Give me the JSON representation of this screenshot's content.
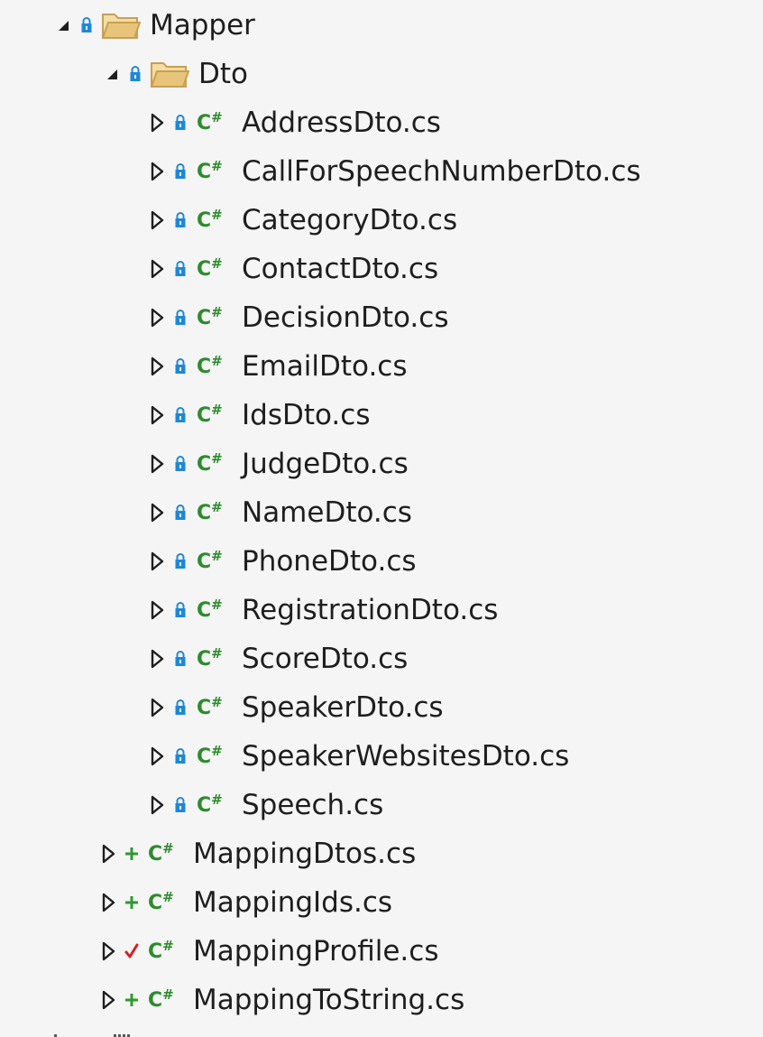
{
  "tree": {
    "root": {
      "label": "Mapper",
      "expanded": true,
      "status_icon": "lock-icon",
      "icon": "folder-icon"
    },
    "dto_folder": {
      "label": "Dto",
      "expanded": true,
      "status_icon": "lock-icon",
      "icon": "folder-icon"
    },
    "dto_files": [
      {
        "label": "AddressDto.cs",
        "status_icon": "lock-icon",
        "icon": "csharp-file-icon"
      },
      {
        "label": "CallForSpeechNumberDto.cs",
        "status_icon": "lock-icon",
        "icon": "csharp-file-icon"
      },
      {
        "label": "CategoryDto.cs",
        "status_icon": "lock-icon",
        "icon": "csharp-file-icon"
      },
      {
        "label": "ContactDto.cs",
        "status_icon": "lock-icon",
        "icon": "csharp-file-icon"
      },
      {
        "label": "DecisionDto.cs",
        "status_icon": "lock-icon",
        "icon": "csharp-file-icon"
      },
      {
        "label": "EmailDto.cs",
        "status_icon": "lock-icon",
        "icon": "csharp-file-icon"
      },
      {
        "label": "IdsDto.cs",
        "status_icon": "lock-icon",
        "icon": "csharp-file-icon"
      },
      {
        "label": "JudgeDto.cs",
        "status_icon": "lock-icon",
        "icon": "csharp-file-icon"
      },
      {
        "label": "NameDto.cs",
        "status_icon": "lock-icon",
        "icon": "csharp-file-icon"
      },
      {
        "label": "PhoneDto.cs",
        "status_icon": "lock-icon",
        "icon": "csharp-file-icon"
      },
      {
        "label": "RegistrationDto.cs",
        "status_icon": "lock-icon",
        "icon": "csharp-file-icon"
      },
      {
        "label": "ScoreDto.cs",
        "status_icon": "lock-icon",
        "icon": "csharp-file-icon"
      },
      {
        "label": "SpeakerDto.cs",
        "status_icon": "lock-icon",
        "icon": "csharp-file-icon"
      },
      {
        "label": "SpeakerWebsitesDto.cs",
        "status_icon": "lock-icon",
        "icon": "csharp-file-icon"
      },
      {
        "label": "Speech.cs",
        "status_icon": "lock-icon",
        "icon": "csharp-file-icon"
      }
    ],
    "mapper_files": [
      {
        "label": "MappingDtos.cs",
        "status_icon": "plus-icon",
        "icon": "csharp-file-icon"
      },
      {
        "label": "MappingIds.cs",
        "status_icon": "plus-icon",
        "icon": "csharp-file-icon"
      },
      {
        "label": "MappingProfile.cs",
        "status_icon": "check-icon",
        "icon": "csharp-file-icon"
      },
      {
        "label": "MappingToString.cs",
        "status_icon": "plus-icon",
        "icon": "csharp-file-icon"
      }
    ],
    "csharp_glyph": "C",
    "csharp_hash": "#"
  },
  "colors": {
    "background": "#f5f5f5",
    "text": "#1e1e1e",
    "lock_blue": "#1e88d6",
    "plus_green": "#2e9b2e",
    "check_red": "#d42020",
    "csharp_green": "#2e8b2e",
    "folder_fill": "#e8c47a",
    "folder_stroke": "#c9a04e"
  }
}
